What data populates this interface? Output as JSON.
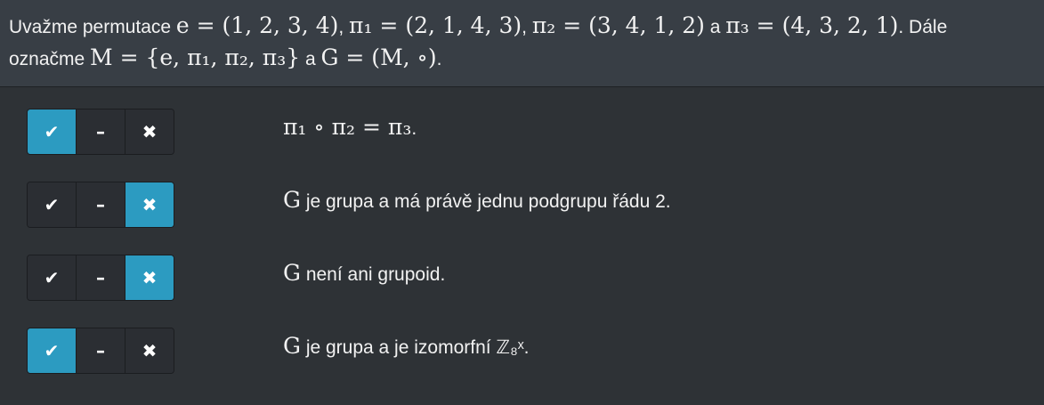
{
  "intro": {
    "line1_text1": "Uvažme permutace ",
    "line1_math_e": "e = (1, 2, 3, 4)",
    "line1_sep1": ", ",
    "line1_math_pi1": "π₁ = (2, 1, 4, 3)",
    "line1_sep2": ", ",
    "line1_math_pi2": "π₂ = (3, 4, 1, 2)",
    "line1_and": " a ",
    "line1_math_pi3": "π₃ = (4, 3, 2, 1)",
    "line1_end": ". Dále",
    "line2_text1": "označme ",
    "line2_math_M": "M = {e, π₁, π₂, π₃}",
    "line2_and": " a ",
    "line2_math_G": "G = (M, ∘)",
    "line2_end": "."
  },
  "buttons": {
    "yes_symbol": "✔",
    "neutral_symbol": "–",
    "no_symbol": "✖"
  },
  "questions": [
    {
      "math_prefix": "π₁ ∘ π₂ = π₃",
      "text": ".",
      "selected": "yes"
    },
    {
      "math_prefix": "G",
      "text": " je grupa a má právě jednu podgrupu řádu 2.",
      "selected": "no"
    },
    {
      "math_prefix": "G",
      "text": " není ani grupoid.",
      "selected": "no"
    },
    {
      "math_prefix": "G",
      "text": " je grupa a je izomorfní ℤ₈ˣ.",
      "selected": "yes"
    }
  ],
  "colors": {
    "background": "#2e3236",
    "header_background": "#383e45",
    "active_button": "#2c9bc1",
    "inactive_button": "#2b2e33"
  }
}
